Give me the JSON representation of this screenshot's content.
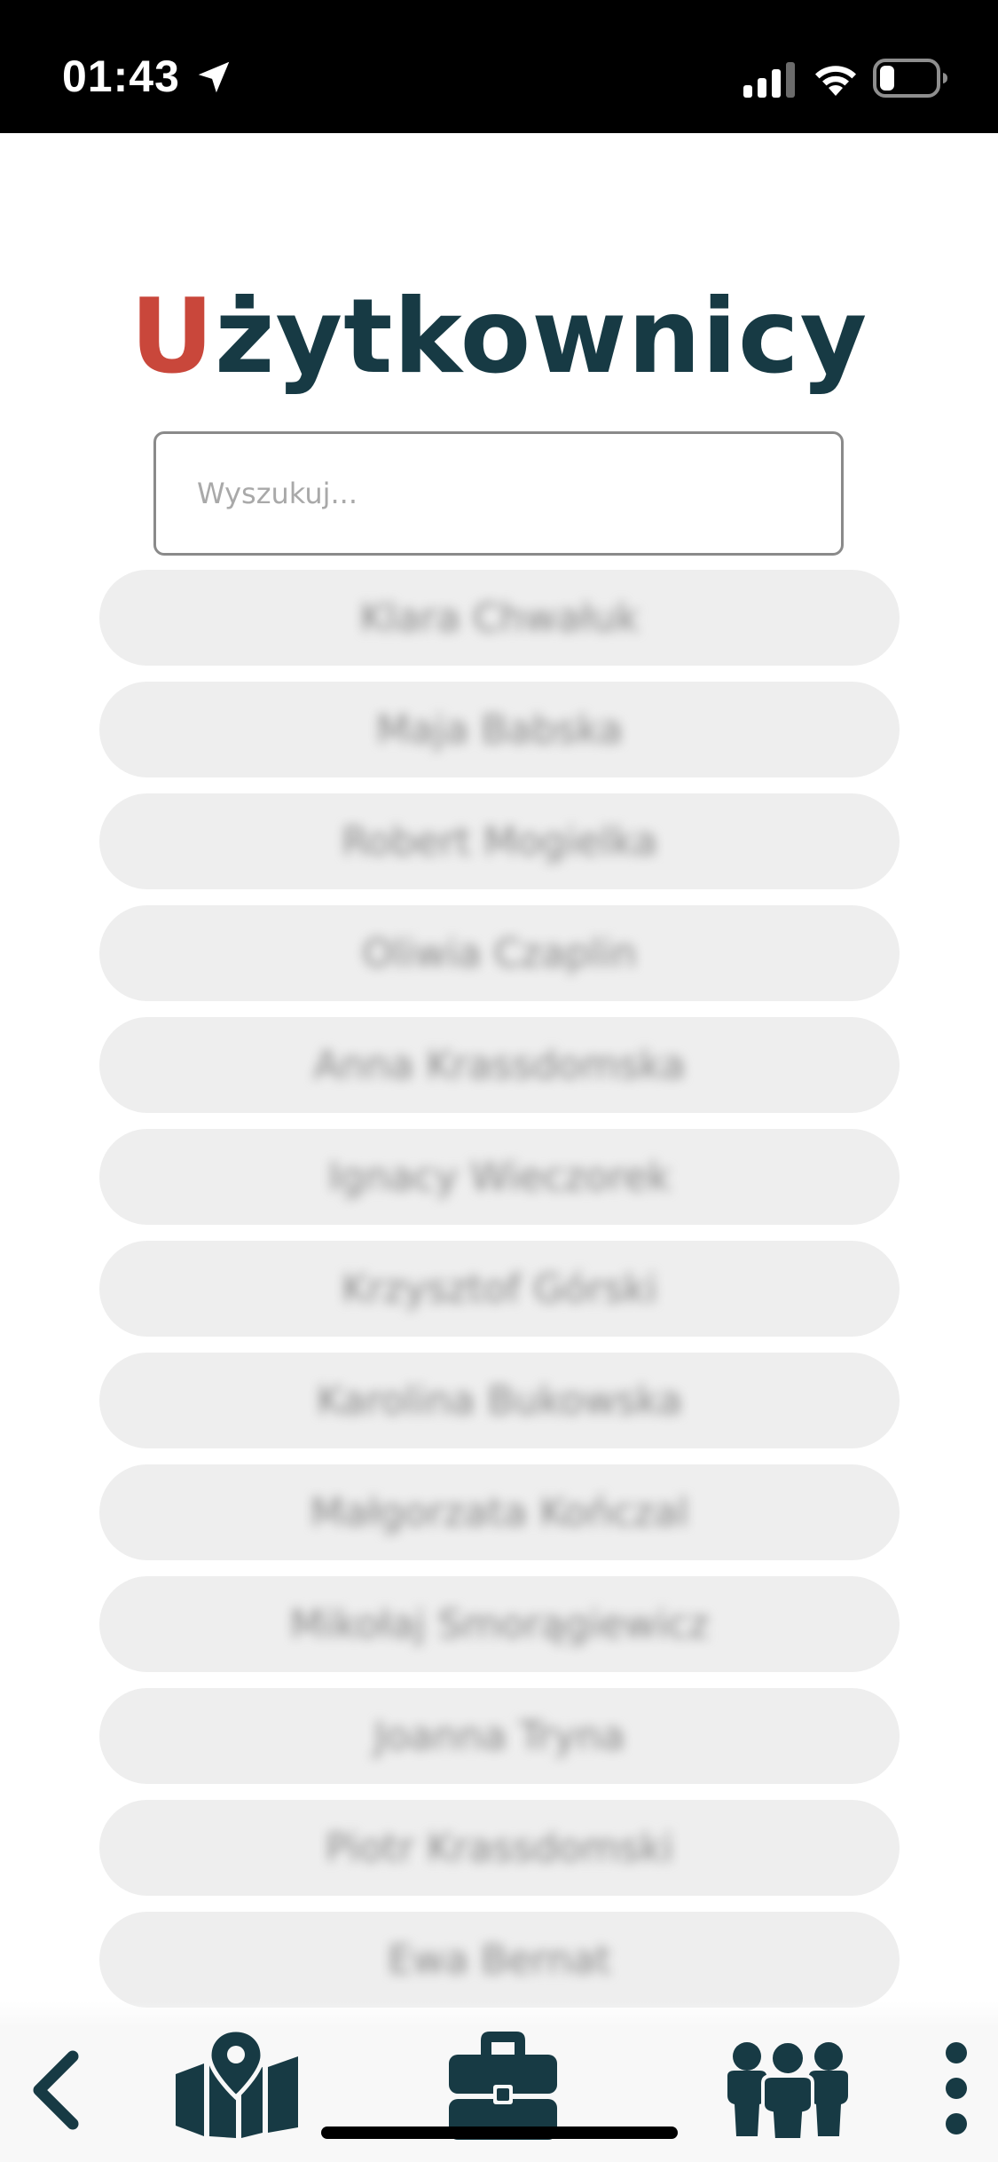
{
  "status_bar": {
    "time": "01:43",
    "icons": [
      "location-arrow-icon",
      "signal-icon",
      "wifi-icon",
      "battery-icon"
    ]
  },
  "header": {
    "title_first_letter": "U",
    "title_rest": "żytkownicy"
  },
  "search": {
    "placeholder": "Wyszukuj...",
    "value": ""
  },
  "users": [
    "Klara Chwałuk",
    "Maja Babska",
    "Robert Mogielka",
    "Oliwia Czaplin",
    "Anna Krassdomska",
    "Ignacy Wieczorek",
    "Krzysztof Górski",
    "Karolina Bukowska",
    "Małgorzata Kończal",
    "Mikołaj Smorągiewicz",
    "Joanna Tryna",
    "Piotr Krassdomski",
    "Ewa Bernat"
  ],
  "bottom_nav": {
    "items": [
      "back-icon",
      "map-icon",
      "briefcase-icon",
      "users-group-icon",
      "more-vertical-icon"
    ]
  },
  "colors": {
    "title_dark": "#173a44",
    "title_accent": "#c9473b",
    "list_item_bg": "#eeeeee",
    "nav_icon": "#173a44"
  }
}
